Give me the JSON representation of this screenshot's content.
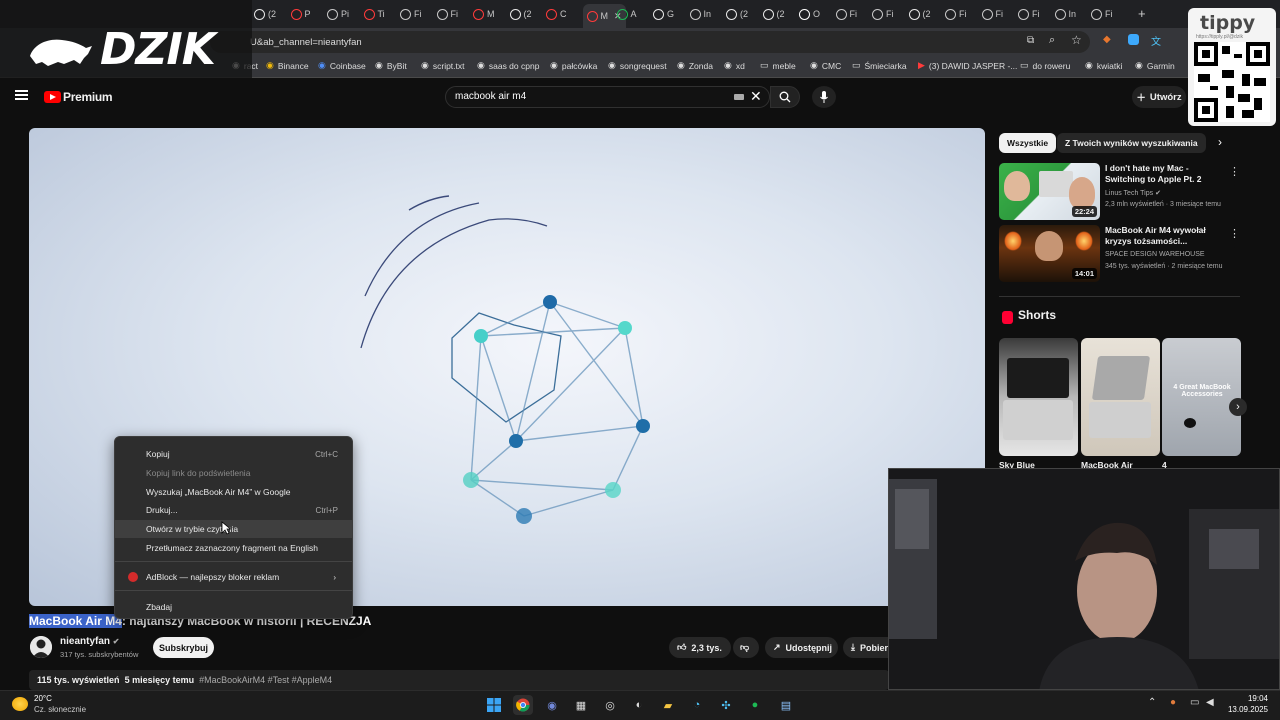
{
  "browser": {
    "tabs": [
      {
        "label": "(2",
        "icon": "x-icon"
      },
      {
        "label": "P",
        "icon": "youtube-icon"
      },
      {
        "label": "Pi",
        "icon": "globe-icon"
      },
      {
        "label": "Ti",
        "icon": "youtube-icon"
      },
      {
        "label": "Fi",
        "icon": "globe-icon"
      },
      {
        "label": "Fi",
        "icon": "globe-icon"
      },
      {
        "label": "M",
        "icon": "youtube-icon"
      },
      {
        "label": "(2",
        "icon": "x-icon"
      },
      {
        "label": "C",
        "icon": "youtube-icon"
      },
      {
        "label": "M",
        "icon": "youtube-icon"
      },
      {
        "label": "A",
        "icon": "spotify-icon"
      },
      {
        "label": "G",
        "icon": "x-icon"
      },
      {
        "label": "In",
        "icon": "globe-icon"
      },
      {
        "label": "(2",
        "icon": "x-icon"
      },
      {
        "label": "(2",
        "icon": "x-icon"
      },
      {
        "label": "O",
        "icon": "notion-icon"
      },
      {
        "label": "Fi",
        "icon": "globe-icon"
      },
      {
        "label": "Fi",
        "icon": "globe-icon"
      },
      {
        "label": "(2",
        "icon": "x-icon"
      },
      {
        "label": "Fi",
        "icon": "globe-icon"
      },
      {
        "label": "Fi",
        "icon": "globe-icon"
      },
      {
        "label": "Fi",
        "icon": "globe-icon"
      },
      {
        "label": "In",
        "icon": "globe-icon"
      },
      {
        "label": "Fi",
        "icon": "globe-icon"
      }
    ],
    "new_tab": "+",
    "url": "U&ab_channel=nieantyfan",
    "bookmarks": [
      {
        "label": "ract",
        "icon": "bookmark-icon"
      },
      {
        "label": "Binance",
        "icon": "binance-icon"
      },
      {
        "label": "Coinbase",
        "icon": "coinbase-icon"
      },
      {
        "label": "ByBit",
        "icon": "bybit-icon"
      },
      {
        "label": "script.txt",
        "icon": "github-icon"
      },
      {
        "label": "saas do cpnp",
        "icon": "globe-icon"
      },
      {
        "label": "pałcówka",
        "icon": "globe-icon"
      },
      {
        "label": "songrequest",
        "icon": "globe-icon"
      },
      {
        "label": "Zonda",
        "icon": "globe-icon"
      },
      {
        "label": "xd",
        "icon": "globe-icon"
      },
      {
        "label": "meble",
        "icon": "folder-icon"
      },
      {
        "label": "CMC",
        "icon": "globe-icon"
      },
      {
        "label": "Śmieciarka",
        "icon": "folder-icon"
      },
      {
        "label": "(3) DAWID JASPER -...",
        "icon": "youtube-icon"
      },
      {
        "label": "do roweru",
        "icon": "folder-icon"
      },
      {
        "label": "kwiatki",
        "icon": "globe-icon"
      },
      {
        "label": "Garmin",
        "icon": "globe-icon"
      }
    ]
  },
  "overlay": {
    "brand": "DZIK",
    "tippy": "tippy",
    "tippy_url": "https://tipply.pl/@dzik"
  },
  "youtube": {
    "logo": "Premium",
    "search_value": "macbook air m4",
    "create_label": "Utwórz",
    "video": {
      "title_selected": "MacBook Air M4",
      "title_rest": ": najtańszy MacBook w historii | RECENZJA",
      "channel": "nieantyfan",
      "subscribers": "317 tys. subskrybentów",
      "subscribe_label": "Subskrybuj",
      "likes": "2,3 tys.",
      "share_label": "Udostępnij",
      "download_label": "Pobierz",
      "views": "115 tys. wyświetleń",
      "age": "5 miesięcy temu",
      "tags": "#MacBookAirM4 #Test #AppleM4"
    },
    "context_menu": [
      {
        "label": "Kopiuj",
        "shortcut": "Ctrl+C",
        "disabled": false
      },
      {
        "label": "Kopiuj link do podświetlenia",
        "shortcut": "",
        "disabled": true
      },
      {
        "label": "Wyszukaj „MacBook Air M4” w Google",
        "shortcut": "",
        "disabled": false
      },
      {
        "label": "Drukuj...",
        "shortcut": "Ctrl+P",
        "disabled": false
      },
      {
        "label": "Otwórz w trybie czytania",
        "shortcut": "",
        "disabled": false
      },
      {
        "label": "Przetłumacz zaznaczony fragment na English",
        "shortcut": "",
        "disabled": false
      },
      {
        "label": "AdBlock — najlepszy bloker reklam",
        "shortcut": "",
        "disabled": false
      },
      {
        "label": "Zbadaj",
        "shortcut": "",
        "disabled": false
      }
    ],
    "chips": [
      "Wszystkie",
      "Z Twoich wyników wyszukiwania"
    ],
    "recommendations": [
      {
        "title": "I don't hate my Mac - Switching to Apple Pt. 2",
        "channel": "Linus Tech Tips",
        "meta": "2,3 mln wyświetleń · 3 miesiące temu",
        "duration": "22:24"
      },
      {
        "title": "MacBook Air M4 wywołał kryzys tożsamości...",
        "channel": "SPACE DESIGN WAREHOUSE",
        "meta": "345 tys. wyświetleń · 2 miesiące temu",
        "duration": "14:01"
      }
    ],
    "shorts_title": "Shorts",
    "shorts": [
      {
        "caption": "Sky Blue",
        "overlay": ""
      },
      {
        "caption": "MacBook Air",
        "overlay": ""
      },
      {
        "caption": "4",
        "overlay": "4 Great MacBook Accessories"
      }
    ]
  },
  "taskbar": {
    "temperature": "20°C",
    "weather": "Cz. słonecznie",
    "time": "19:04",
    "date": "13.09.2025"
  }
}
